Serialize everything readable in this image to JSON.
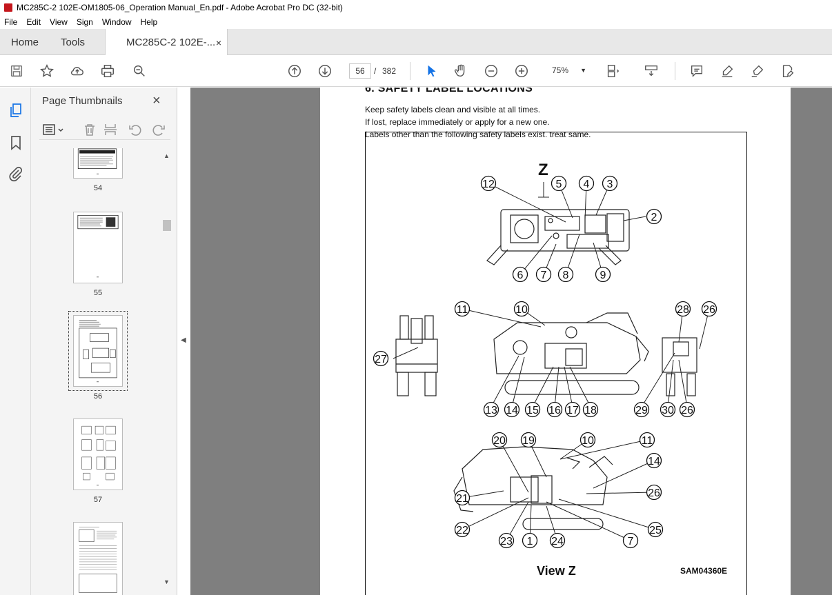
{
  "window": {
    "title": "MC285C-2 102E-OM1805-06_Operation Manual_En.pdf - Adobe Acrobat Pro DC (32-bit)"
  },
  "menu": [
    "File",
    "Edit",
    "View",
    "Sign",
    "Window",
    "Help"
  ],
  "tabs": {
    "home": "Home",
    "tools": "Tools",
    "doc": "MC285C-2 102E-...",
    "close": "×"
  },
  "toolbar": {
    "page_current": "56",
    "page_sep": "/",
    "page_total": "382",
    "zoom": "75%"
  },
  "panel": {
    "title": "Page Thumbnails",
    "close": "×"
  },
  "thumbnails": [
    {
      "label": "54"
    },
    {
      "label": "55"
    },
    {
      "label": "56"
    },
    {
      "label": "57"
    },
    {
      "label": ""
    }
  ],
  "document": {
    "heading": "6. SAFETY LABEL LOCATIONS",
    "lines": [
      "Keep safety labels clean and visible at all times.",
      "If lost, replace immediately or apply for a new one.",
      "Labels other than the following safety labels exist. treat same."
    ],
    "figure": {
      "view_letter": "Z",
      "view_caption": "View Z",
      "figure_code": "SAM04360E",
      "top_callouts": [
        "12",
        "5",
        "4",
        "3",
        "2",
        "6",
        "7",
        "8",
        "9"
      ],
      "middle_callouts": [
        "11",
        "10",
        "28",
        "26",
        "27",
        "13",
        "14",
        "15",
        "16",
        "17",
        "18",
        "29",
        "30",
        "26"
      ],
      "bottom_callouts": [
        "20",
        "19",
        "10",
        "11",
        "14",
        "21",
        "26",
        "22",
        "25",
        "23",
        "1",
        "24",
        "7"
      ]
    }
  }
}
